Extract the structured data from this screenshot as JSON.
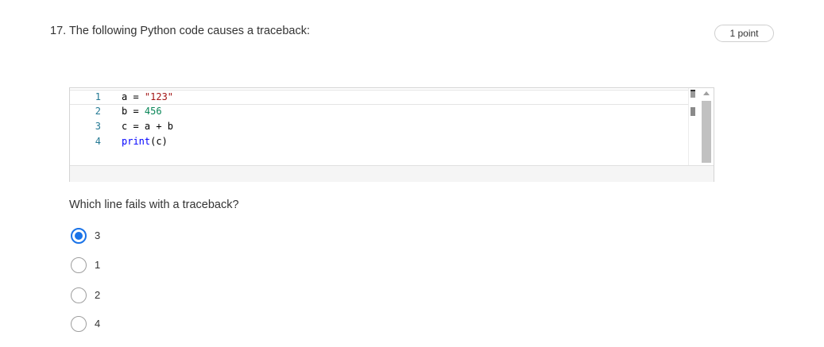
{
  "question": {
    "number": "17.",
    "text": "The following Python code causes a traceback:",
    "points": "1 point"
  },
  "code": {
    "language": "python",
    "lines": [
      {
        "number": "1",
        "text": "a = \"123\""
      },
      {
        "number": "2",
        "text": "b = 456"
      },
      {
        "number": "3",
        "text": "c = a + b"
      },
      {
        "number": "4",
        "text": "print(c)"
      }
    ]
  },
  "prompt": "Which line fails with a traceback?",
  "options": [
    {
      "label": "3",
      "selected": true
    },
    {
      "label": "1",
      "selected": false
    },
    {
      "label": "2",
      "selected": false
    },
    {
      "label": "4",
      "selected": false
    }
  ],
  "colors": {
    "accent": "#1a73e8",
    "string": "#a31515",
    "number": "#098658",
    "keyword": "#0000ff",
    "line_number": "#237893"
  }
}
